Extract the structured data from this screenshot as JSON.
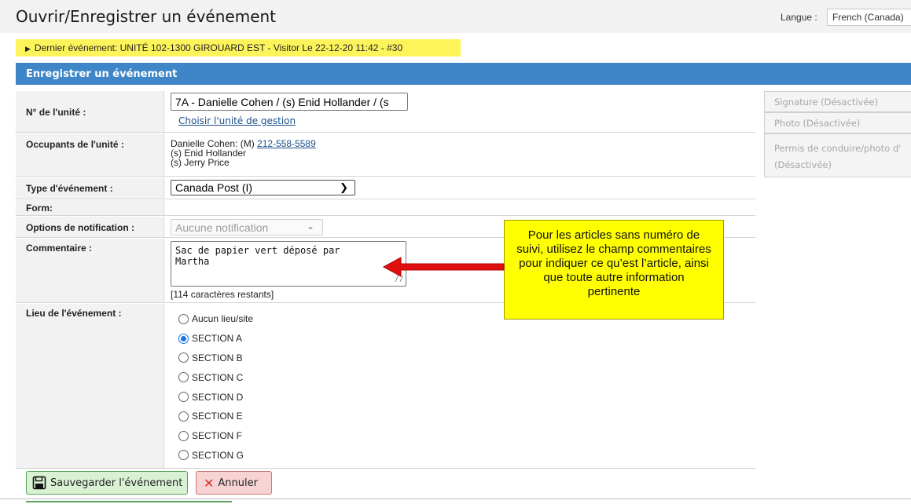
{
  "header": {
    "title": "Ouvrir/Enregistrer un événement",
    "language_label": "Langue :",
    "language_value": "French (Canada)"
  },
  "last_event": {
    "text": "Dernier événement: UNITÉ 102-1300 GIROUARD EST - Visitor Le 22-12-20 11:42 - #30"
  },
  "section": {
    "title": "Enregistrer un événement"
  },
  "form": {
    "unit": {
      "label": "N° de l'unité :",
      "value": "7A - Danielle Cohen / (s) Enid Hollander / (s",
      "link": "Choisir l'unité de gestion"
    },
    "occupants": {
      "label": "Occupants de l'unité :",
      "line1_prefix": "Danielle Cohen: (M) ",
      "phone": "212-558-5589",
      "line2": "(s) Enid Hollander",
      "line3": "(s) Jerry Price"
    },
    "event_type": {
      "label": "Type d'événement :",
      "value": "Canada Post (I)"
    },
    "form_row": {
      "label": "Form:"
    },
    "notification": {
      "label": "Options de notification :",
      "value": "Aucune notification"
    },
    "comment": {
      "label": "Commentaire :",
      "value": "Sac de papier vert déposé par\nMartha",
      "chars_left": "[114 caractères restants]"
    },
    "location": {
      "label": "Lieu de l'événement :",
      "options": [
        {
          "label": "Aucun lieu/site",
          "checked": false
        },
        {
          "label": "SECTION A",
          "checked": true
        },
        {
          "label": "SECTION B",
          "checked": false
        },
        {
          "label": "SECTION C",
          "checked": false
        },
        {
          "label": "SECTION D",
          "checked": false
        },
        {
          "label": "SECTION E",
          "checked": false
        },
        {
          "label": "SECTION F",
          "checked": false
        },
        {
          "label": "SECTION G",
          "checked": false
        }
      ]
    }
  },
  "side_panel": {
    "signature": "Signature (Désactivée)",
    "photo": "Photo (Désactivée)",
    "license_line1": "Permis de conduire/photo d'",
    "license_line2": "(Désactivée)"
  },
  "callout": {
    "text": "Pour les articles sans numéro de suivi, utilisez le champ commentaires pour indiquer ce qu’est l’article, ainsi que toute autre information pertinente"
  },
  "actions": {
    "save": "Sauvegarder l'événement",
    "cancel": "Annuler"
  },
  "colors": {
    "header_blue": "#3e86c8",
    "highlight_yellow": "#fdf35b",
    "callout_yellow": "#ffff00",
    "arrow_red": "#e01010",
    "save_green": "#d9f2d4",
    "cancel_red": "#f7d3d3"
  },
  "icons": {
    "save": "floppy-disk-icon",
    "cancel": "close-icon",
    "last_event": "triangle-right-icon",
    "select": "chevron-down-icon"
  }
}
